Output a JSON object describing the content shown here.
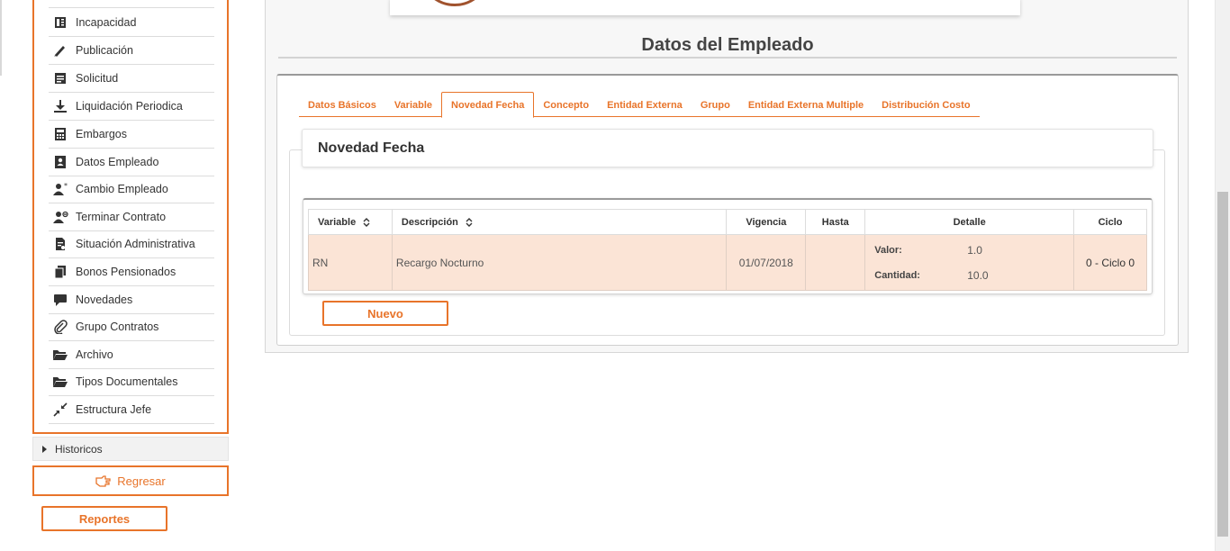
{
  "sidebar": {
    "items": [
      {
        "label": "Incapacidad",
        "icon": "book-icon"
      },
      {
        "label": "Publicación",
        "icon": "pen-icon"
      },
      {
        "label": "Solicitud",
        "icon": "document-icon"
      },
      {
        "label": "Liquidación Periodica",
        "icon": "download-icon"
      },
      {
        "label": "Embargos",
        "icon": "calculator-icon"
      },
      {
        "label": "Datos Empleado",
        "icon": "contact-card-icon"
      },
      {
        "label": "Cambio Empleado",
        "icon": "user-change-icon"
      },
      {
        "label": "Terminar Contrato",
        "icon": "user-remove-icon"
      },
      {
        "label": "Situación Administrativa",
        "icon": "file-report-icon"
      },
      {
        "label": "Bonos Pensionados",
        "icon": "files-icon"
      },
      {
        "label": "Novedades",
        "icon": "chat-bubble-icon"
      },
      {
        "label": "Grupo Contratos",
        "icon": "paperclip-icon"
      },
      {
        "label": "Archivo",
        "icon": "folder-open-icon"
      },
      {
        "label": "Tipos Documentales",
        "icon": "folder-open-icon"
      },
      {
        "label": "Estructura Jefe",
        "icon": "compress-arrows-icon"
      }
    ],
    "historicos_label": "Historicos",
    "regresar_label": "Regresar",
    "reportes_label": "Reportes"
  },
  "main": {
    "title": "Datos del Empleado",
    "tabs": [
      {
        "label": "Datos Básicos",
        "active": false
      },
      {
        "label": "Variable",
        "active": false
      },
      {
        "label": "Novedad Fecha",
        "active": true
      },
      {
        "label": "Concepto",
        "active": false
      },
      {
        "label": "Entidad Externa",
        "active": false
      },
      {
        "label": "Grupo",
        "active": false
      },
      {
        "label": "Entidad Externa Multiple",
        "active": false
      },
      {
        "label": "Distribución Costo",
        "active": false
      }
    ],
    "panel_title": "Novedad Fecha",
    "table": {
      "headers": {
        "variable": "Variable",
        "descripcion": "Descripción",
        "vigencia": "Vigencia",
        "hasta": "Hasta",
        "detalle": "Detalle",
        "ciclo": "Ciclo"
      },
      "rows": [
        {
          "variable": "RN",
          "descripcion": "Recargo Nocturno",
          "vigencia": "01/07/2018",
          "hasta": "",
          "valor_label": "Valor:",
          "valor": "1.0",
          "cantidad_label": "Cantidad:",
          "cantidad": "10.0",
          "ciclo": "0 - Ciclo 0"
        }
      ]
    },
    "nuevo_label": "Nuevo"
  },
  "colors": {
    "accent": "#e8742a",
    "row_highlight": "#fbe4d6"
  }
}
